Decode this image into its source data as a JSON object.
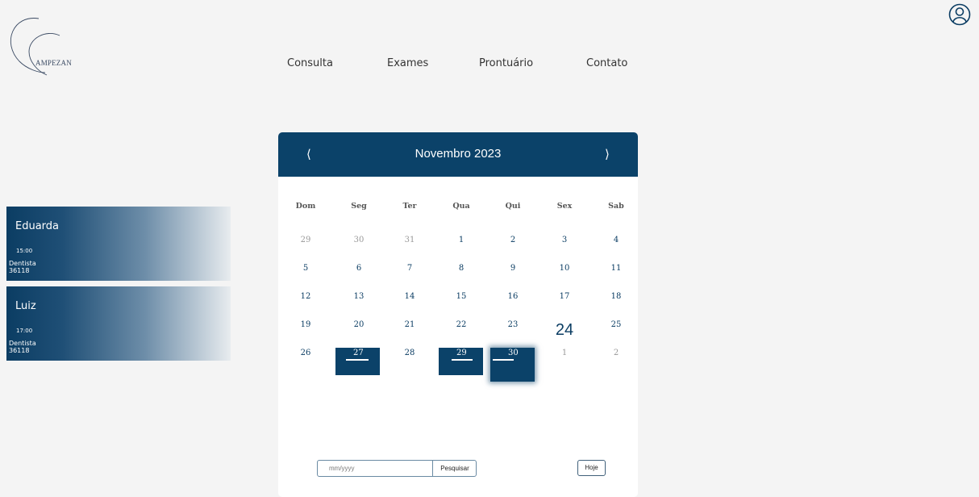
{
  "brand": {
    "logo_text": "AMPEZAN"
  },
  "nav": {
    "items": [
      "Consulta",
      "Exames",
      "Prontuário",
      "Contato"
    ]
  },
  "appointments": [
    {
      "name": "Eduarda",
      "time": "15:00",
      "specialty": "Dentista",
      "code": "36118"
    },
    {
      "name": "Luiz",
      "time": "17:00",
      "specialty": "Dentista",
      "code": "36118"
    }
  ],
  "calendar": {
    "title": "Novembro 2023",
    "prev": "⟨",
    "next": "⟩",
    "weekdays": [
      "Dom",
      "Seg",
      "Ter",
      "Qua",
      "Qui",
      "Sex",
      "Sab"
    ],
    "weeks": [
      [
        "29",
        "30",
        "31",
        "1",
        "2",
        "3",
        "4"
      ],
      [
        "5",
        "6",
        "7",
        "8",
        "9",
        "10",
        "11"
      ],
      [
        "12",
        "13",
        "14",
        "15",
        "16",
        "17",
        "18"
      ],
      [
        "19",
        "20",
        "21",
        "22",
        "23",
        "24",
        "25"
      ],
      [
        "26",
        "27",
        "28",
        "29",
        "30",
        "1",
        "2"
      ]
    ],
    "today": "24",
    "marked_days": [
      "27",
      "29",
      "30"
    ],
    "focused_day": "30"
  },
  "search": {
    "placeholder": "mm/yyyy",
    "button": "Pesquisar"
  },
  "today_button": "Hoje",
  "colors": {
    "primary": "#0b4269",
    "background": "#f4f4f4"
  }
}
